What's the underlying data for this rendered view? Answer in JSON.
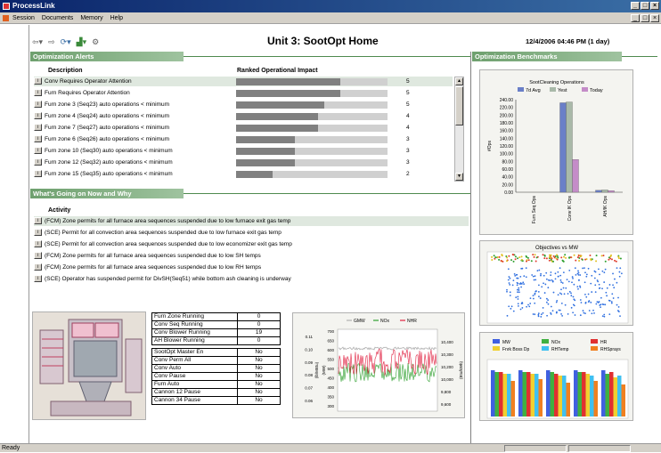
{
  "window": {
    "title": "ProcessLink",
    "controls": [
      "_",
      "□",
      "×"
    ]
  },
  "menu": {
    "items": [
      "Session",
      "Documents",
      "Memory",
      "Help"
    ],
    "mdi_controls": [
      "_",
      "□",
      "×"
    ]
  },
  "header": {
    "title": "Unit 3: SootOpt Home",
    "datetime": "12/4/2006 04:46 PM (1 day)"
  },
  "alerts": {
    "section_title": "Optimization Alerts",
    "col_description": "Description",
    "col_impact": "Ranked Operational Impact",
    "rows": [
      {
        "text": "Conv Requires Operator Attention",
        "impact": 5,
        "fill": 0.69
      },
      {
        "text": "Furn Requires Operator Attention",
        "impact": 5,
        "fill": 0.69
      },
      {
        "text": "Furn zone 3 (Seq23) auto operations < minimum",
        "impact": 5,
        "fill": 0.58
      },
      {
        "text": "Furn zone 4 (Seq24) auto operations < minimum",
        "impact": 4,
        "fill": 0.54
      },
      {
        "text": "Furn zone 7 (Seq27) auto operations < minimum",
        "impact": 4,
        "fill": 0.54
      },
      {
        "text": "Furn zone 6 (Seq26) auto operations < minimum",
        "impact": 3,
        "fill": 0.39
      },
      {
        "text": "Furn zone 10 (Seq30) auto operations < minimum",
        "impact": 3,
        "fill": 0.39
      },
      {
        "text": "Furn zone 12 (Seq32) auto operations < minimum",
        "impact": 3,
        "fill": 0.39
      },
      {
        "text": "Furn zone 15 (Seq35) auto operations < minimum",
        "impact": 2,
        "fill": 0.24
      }
    ]
  },
  "activity": {
    "section_title": "What's Going on Now and Why",
    "col_activity": "Activity",
    "rows": [
      "(FCM) Zone permits for all furnace area sequences suspended due to low furnace exit gas temp",
      "(SCE) Permit for all convection area sequences suspended due to low furnace exit gas temp",
      "(SCE) Permit for all convection area sequences suspended due to low economizer exit gas temp",
      "(FCM) Zone permits for all furnace area sequences suspended due to low SH temps",
      "(FCM) Zone permits for all furnace area sequences suspended due to low RH temps",
      "(SCE) Operator has suspended permit for DivSH(Seq51) while bottom ash cleaning is underway"
    ]
  },
  "status_table": {
    "group1": [
      {
        "label": "Furn Zone Running",
        "value": "0"
      },
      {
        "label": "Conv Seq Running",
        "value": "0"
      },
      {
        "label": "Conv Blower Running",
        "value": "19"
      },
      {
        "label": "AH Blower Running",
        "value": "0"
      }
    ],
    "group2": [
      {
        "label": "SootOpt Master En",
        "value": "No"
      },
      {
        "label": "Conv Perm All",
        "value": "No"
      },
      {
        "label": "Conv Auto",
        "value": "No"
      },
      {
        "label": "Conv Pause",
        "value": "No"
      },
      {
        "label": "Furn Auto",
        "value": "No"
      },
      {
        "label": "Cannon 12 Pause",
        "value": "No"
      },
      {
        "label": "Cannon 34 Pause",
        "value": "No"
      }
    ]
  },
  "benchmarks": {
    "section_title": "Optimization Benchmarks"
  },
  "chart_data": [
    {
      "type": "bar",
      "title": "SootCleaning Operations",
      "ylabel": "#Ops",
      "categories": [
        "Furn Seq Ops",
        "Conv IK Ops",
        "AH/IK Ops"
      ],
      "series": [
        {
          "name": "7d Avg",
          "color": "#6a7fc8",
          "values": [
            0,
            232,
            5
          ]
        },
        {
          "name": "Yest",
          "color": "#a9b9a9",
          "values": [
            0,
            234,
            6
          ]
        },
        {
          "name": "Today",
          "color": "#c48cc8",
          "values": [
            0,
            85,
            4
          ]
        }
      ],
      "ylim": [
        0,
        240
      ],
      "yticks": [
        "240.00",
        "220.00",
        "200.00",
        "180.00",
        "160.00",
        "140.00",
        "120.00",
        "100.00",
        "80.00",
        "60.00",
        "40.00",
        "20.00",
        "0.00"
      ]
    },
    {
      "type": "scatter",
      "title": "Objectives vs MW"
    },
    {
      "type": "line",
      "legend": [
        "GMW",
        "NOx",
        "NHR"
      ],
      "colors": {
        "GMW": "#b0b0b0",
        "NOx": "#30a030",
        "NHR": "#e02040"
      },
      "left_axis1": [
        "0.11",
        "0.10",
        "0.09",
        "0.08",
        "0.07",
        "0.06"
      ],
      "left_axis2": [
        "700",
        "650",
        "600",
        "550",
        "500",
        "450",
        "400",
        "350",
        "300"
      ],
      "right_axis": [
        "10,400",
        "10,300",
        "10,200",
        "10,000",
        "9,800",
        "9,600"
      ],
      "left_label1": "(lb/MBtu)",
      "left_label2": "(MW)",
      "right_label": "(Btu/kWh)"
    },
    {
      "type": "bar",
      "legend": [
        {
          "name": "MW",
          "color": "#4060e0"
        },
        {
          "name": "NOx",
          "color": "#40b040"
        },
        {
          "name": "HR",
          "color": "#e03030"
        },
        {
          "name": "Fnrk Boss Dp",
          "color": "#f0d030"
        },
        {
          "name": "RHTemp",
          "color": "#40c0f0"
        },
        {
          "name": "RHSprays",
          "color": "#f08020"
        }
      ]
    }
  ],
  "statusbar": {
    "text": "Ready"
  },
  "toolbar": {
    "icons": [
      "back-arrow-icon",
      "forward-arrow-icon",
      "refresh-icon",
      "chart-icon",
      "settings-icon"
    ]
  }
}
